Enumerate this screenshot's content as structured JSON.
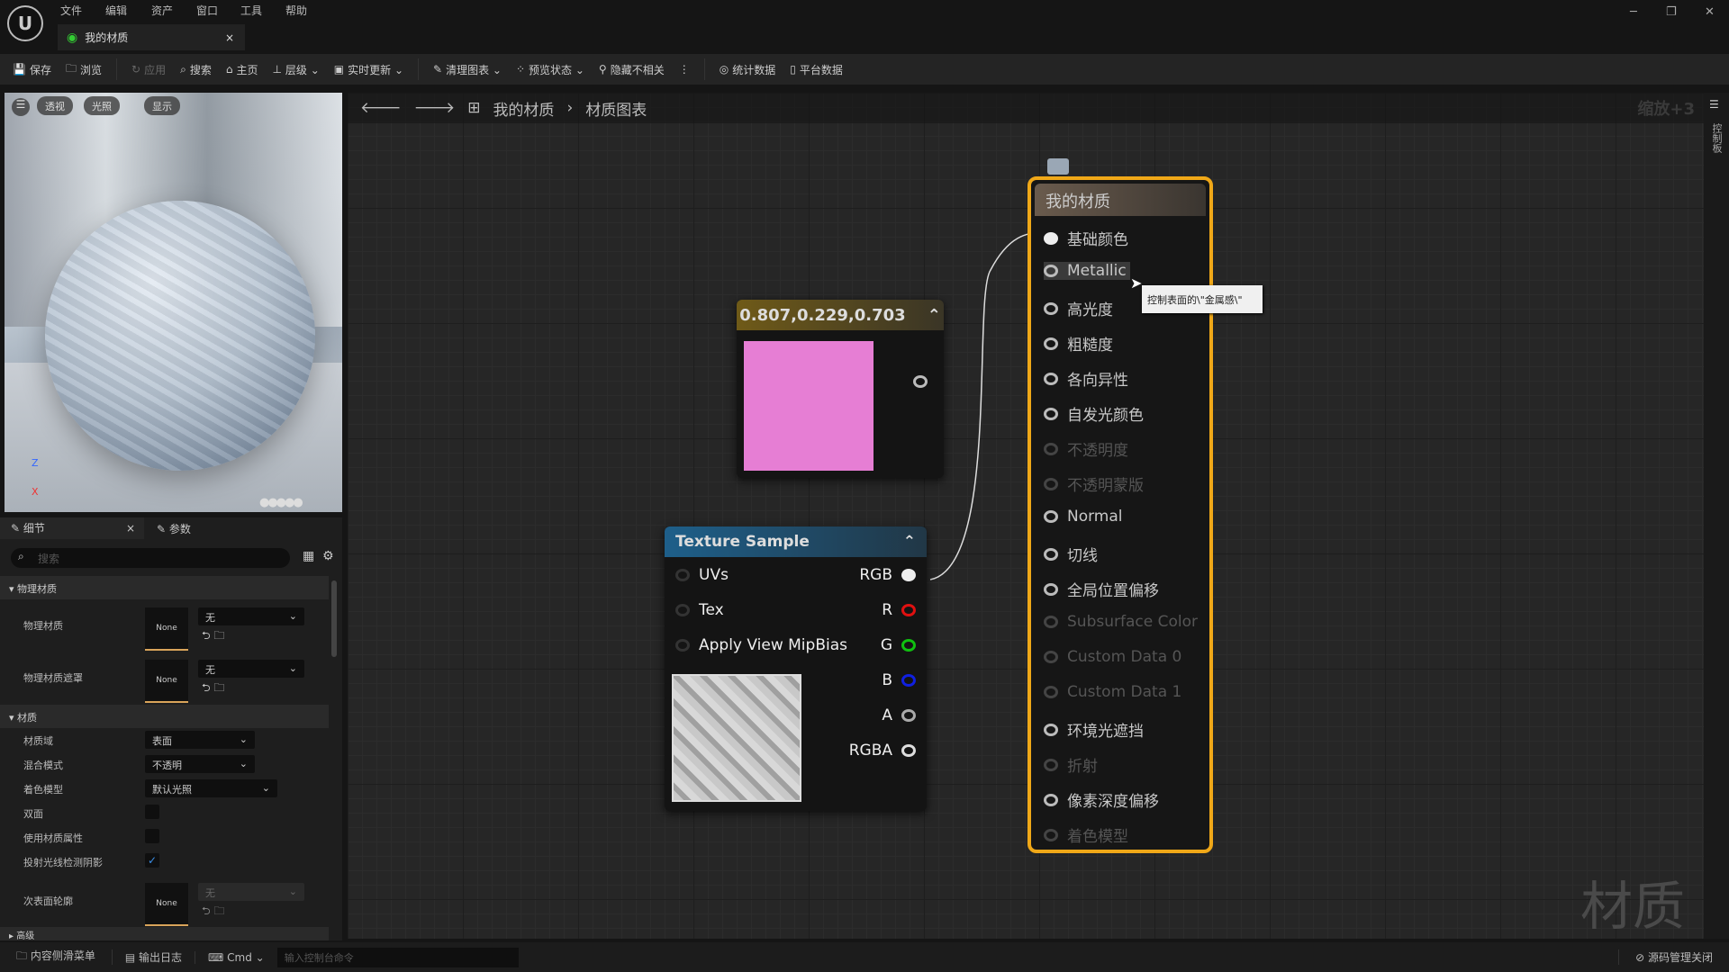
{
  "menu": [
    "文件",
    "编辑",
    "资产",
    "窗口",
    "工具",
    "帮助"
  ],
  "tab": {
    "title": "我的材质",
    "close": "×"
  },
  "window": {
    "min": "─",
    "max": "❐",
    "close": "✕"
  },
  "toolbar": [
    {
      "label": "保存",
      "icon": "save-icon",
      "disabled": false
    },
    {
      "label": "浏览",
      "icon": "browse-icon",
      "disabled": false
    },
    {
      "label": "应用",
      "icon": "apply-icon",
      "disabled": true
    },
    {
      "label": "搜索",
      "icon": "search-icon",
      "disabled": false
    },
    {
      "label": "主页",
      "icon": "home-icon",
      "disabled": false
    },
    {
      "label": "层级 ⌄",
      "icon": "hierarchy-icon",
      "disabled": false
    },
    {
      "label": "实时更新 ⌄",
      "icon": "live-update-icon",
      "disabled": false
    },
    {
      "label": "清理图表 ⌄",
      "icon": "clean-graph-icon",
      "disabled": false
    },
    {
      "label": "预览状态 ⌄",
      "icon": "preview-state-icon",
      "disabled": false
    },
    {
      "label": "隐藏不相关",
      "icon": "hide-unrelated-icon",
      "disabled": false
    },
    {
      "label": "统计数据",
      "icon": "stats-icon",
      "disabled": false
    },
    {
      "label": "平台数据",
      "icon": "platform-icon",
      "disabled": false
    }
  ],
  "viewport": {
    "buttons": [
      "透视",
      "光照",
      "显示"
    ],
    "axis_z": "Z",
    "axis_x": "X"
  },
  "details": {
    "tabs": [
      "细节",
      "参数"
    ],
    "search_placeholder": "搜索",
    "cat_physical": "物理材质",
    "phys_mat": {
      "label": "物理材质",
      "thumb": "None",
      "value": "无"
    },
    "phys_mask": {
      "label": "物理材质遮罩",
      "thumb": "None",
      "value": "无"
    },
    "cat_material": "材质",
    "domain": {
      "label": "材质域",
      "value": "表面"
    },
    "blend": {
      "label": "混合模式",
      "value": "不透明"
    },
    "shading": {
      "label": "着色模型",
      "value": "默认光照"
    },
    "two_sided": {
      "label": "双面",
      "checked": false
    },
    "use_attrs": {
      "label": "使用材质属性",
      "checked": false
    },
    "raytrace": {
      "label": "投射光线检测阴影",
      "checked": true,
      "mark": "✓"
    },
    "subsurface": {
      "label": "次表面轮廓",
      "thumb": "None",
      "value": "无"
    },
    "cat_advanced": "高级"
  },
  "graph": {
    "breadcrumb": [
      "我的材质",
      "材质图表"
    ],
    "zoom": "缩放+3",
    "side_tab": "控制板",
    "watermark": "材质",
    "constant": {
      "title": "0.807,0.229,0.703",
      "color": "#e67ed4"
    },
    "texture": {
      "title": "Texture Sample",
      "inputs": [
        "UVs",
        "Tex",
        "Apply View MipBias"
      ],
      "outputs": [
        {
          "label": "RGB",
          "color": "#eeeeee"
        },
        {
          "label": "R",
          "color": "#e01010"
        },
        {
          "label": "G",
          "color": "#10c010"
        },
        {
          "label": "B",
          "color": "#1020e0"
        },
        {
          "label": "A",
          "color": "#aaaaaa"
        },
        {
          "label": "RGBA",
          "color": "#dddddd"
        }
      ]
    },
    "result": {
      "title": "我的材质",
      "pins": [
        {
          "label": "基础颜色",
          "on": true
        },
        {
          "label": "Metallic",
          "on": true
        },
        {
          "label": "高光度",
          "on": true
        },
        {
          "label": "粗糙度",
          "on": true
        },
        {
          "label": "各向异性",
          "on": true
        },
        {
          "label": "自发光颜色",
          "on": true
        },
        {
          "label": "不透明度",
          "on": false
        },
        {
          "label": "不透明蒙版",
          "on": false
        },
        {
          "label": "Normal",
          "on": true
        },
        {
          "label": "切线",
          "on": true
        },
        {
          "label": "全局位置偏移",
          "on": true
        },
        {
          "label": "Subsurface Color",
          "on": false
        },
        {
          "label": "Custom Data 0",
          "on": false
        },
        {
          "label": "Custom Data 1",
          "on": false
        },
        {
          "label": "环境光遮挡",
          "on": true
        },
        {
          "label": "折射",
          "on": false
        },
        {
          "label": "像素深度偏移",
          "on": true
        },
        {
          "label": "着色模型",
          "on": false
        }
      ]
    },
    "tooltip": "控制表面的\\\"金属感\\\""
  },
  "status": {
    "content_drawer": "内容侧滑菜单",
    "output_log": "输出日志",
    "cmd": "Cmd ⌄",
    "console_placeholder": "输入控制台命令",
    "source_control": "源码管理关闭"
  },
  "accent": "#f0a818"
}
